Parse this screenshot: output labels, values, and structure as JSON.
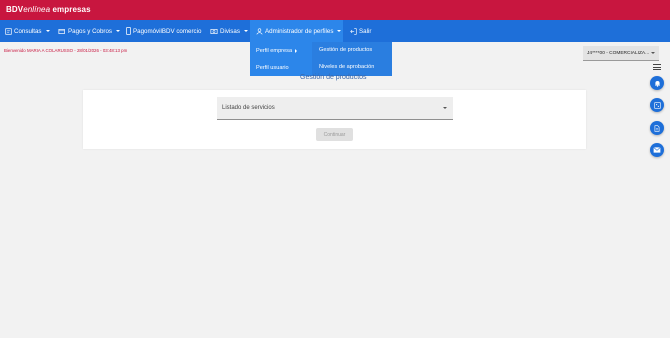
{
  "brand": {
    "part1": "BDV",
    "part2": "enlínea",
    "part3": " empresas"
  },
  "nav": {
    "consultas": "Consultas",
    "pagos_cobros": "Pagos y Cobros",
    "pagomovil": "PagomóvilBDV comercio",
    "divisas": "Divisas",
    "admin_perfiles": "Administrador de perfiles",
    "salir": "Salir"
  },
  "dropdown": {
    "perfil_empresa": "Perfil empresa",
    "perfil_usuario": "Perfil usuario",
    "gestion_productos": "Gestión de productos",
    "niveles_aprobacion": "Niveles de aprobación"
  },
  "welcome_text": "Bienvenido MARIA A COLARUSSO - 28/01/2026 - 03:48:13 pm",
  "account_select": {
    "value": "J4****00 - COMERCIALIZA..."
  },
  "page_title": "Gestión de productos",
  "service_select": {
    "placeholder": "Listado de servicios"
  },
  "continue_button": "Continuar",
  "icons": {
    "consultas": "document-search-icon",
    "pagos": "payments-icon",
    "pagomovil": "mobile-phone-icon",
    "divisas": "currency-exchange-icon",
    "admin": "users-icon",
    "salir": "logout-icon",
    "menu": "hamburger-menu-icon",
    "fab1": "notification-bell-icon",
    "fab2": "qr-code-icon",
    "fab3": "document-icon",
    "fab4": "mail-icon"
  },
  "colors": {
    "brand_red": "#c8163f",
    "nav_blue": "#1e6fd9",
    "active_blue": "#2c86ea"
  }
}
